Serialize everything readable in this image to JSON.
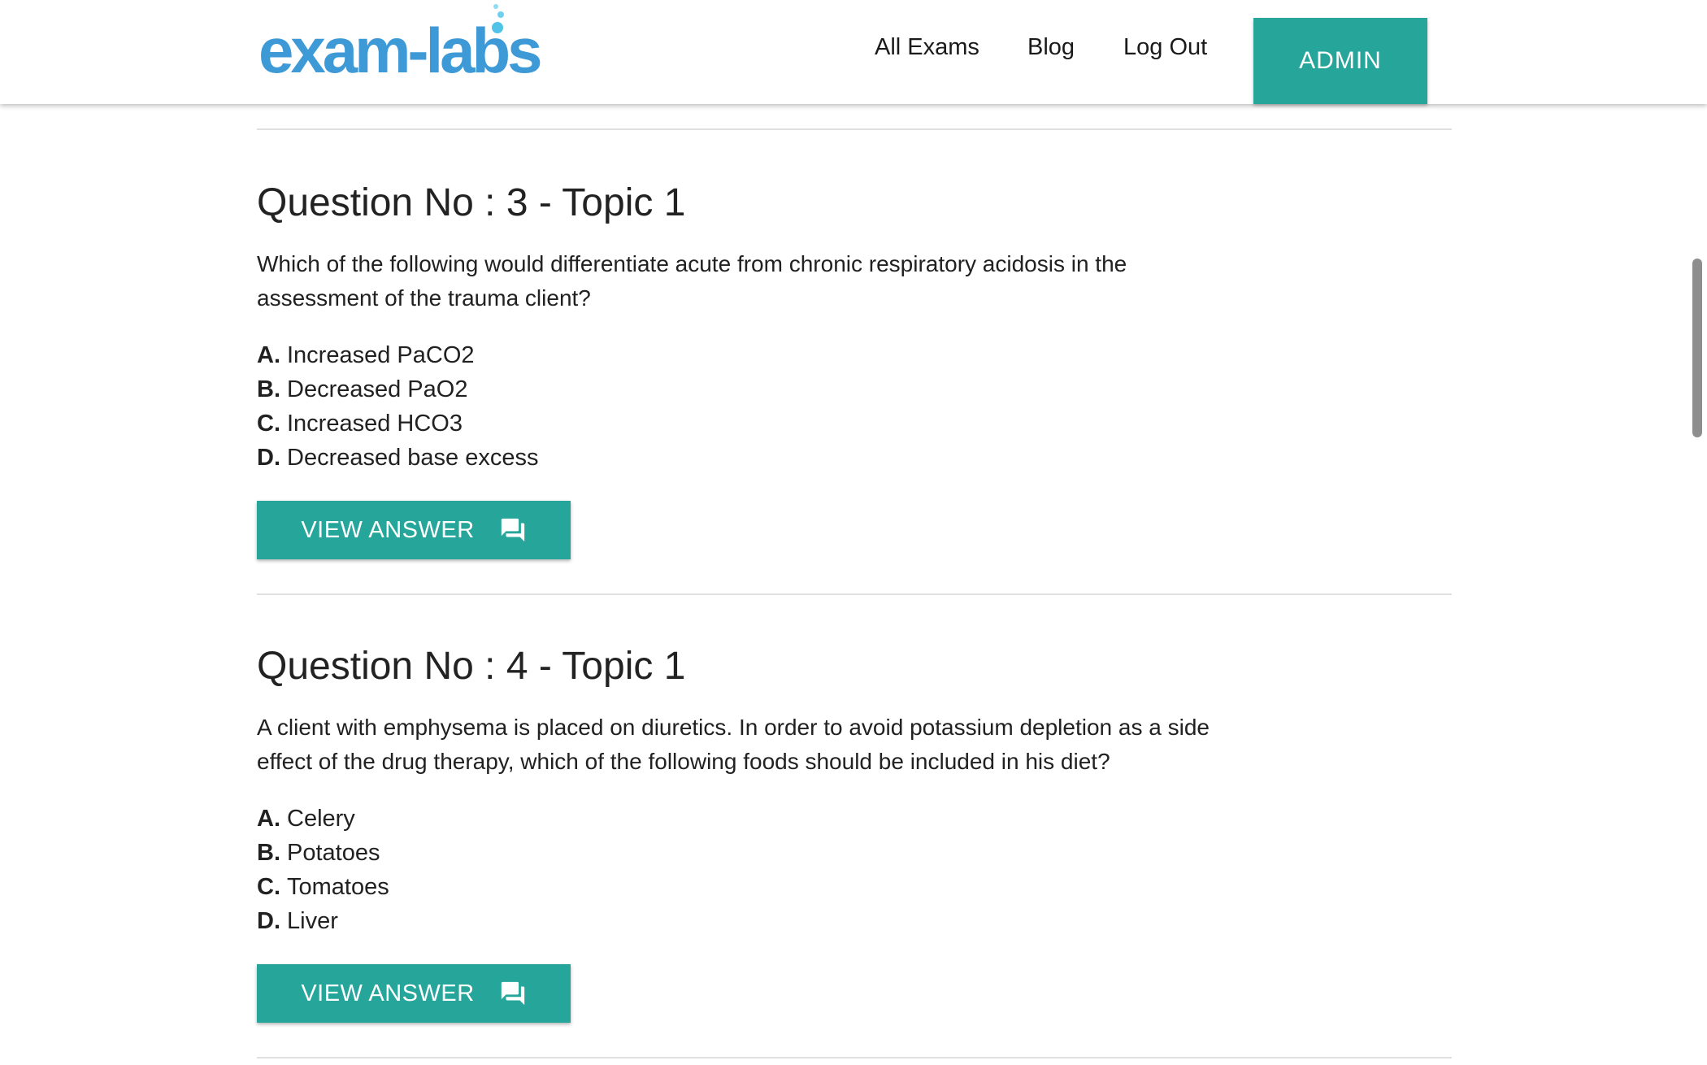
{
  "header": {
    "logo_text": "exam-labs",
    "nav": {
      "all_exams": "All Exams",
      "blog": "Blog",
      "log_out": "Log Out",
      "admin": "ADMIN"
    }
  },
  "colors": {
    "accent": "#26a69a",
    "logo": "#3d9ad6"
  },
  "questions": [
    {
      "title": "Question No : 3 - Topic 1",
      "text": "Which of the following would differentiate acute from chronic respiratory acidosis in the assessment of the trauma client?",
      "options": [
        {
          "letter": "A.",
          "text": "Increased PaCO2"
        },
        {
          "letter": "B.",
          "text": "Decreased PaO2"
        },
        {
          "letter": "C.",
          "text": "Increased HCO3"
        },
        {
          "letter": "D.",
          "text": "Decreased base excess"
        }
      ],
      "button_label": "VIEW ANSWER",
      "button_icon": "forum-icon"
    },
    {
      "title": "Question No : 4 - Topic 1",
      "text": "A client with emphysema is placed on diuretics. In order to avoid potassium depletion as a side effect of the drug therapy, which of the following foods should be included in his diet?",
      "options": [
        {
          "letter": "A.",
          "text": "Celery"
        },
        {
          "letter": "B.",
          "text": "Potatoes"
        },
        {
          "letter": "C.",
          "text": "Tomatoes"
        },
        {
          "letter": "D.",
          "text": "Liver"
        }
      ],
      "button_label": "VIEW ANSWER",
      "button_icon": "forum-icon"
    }
  ]
}
